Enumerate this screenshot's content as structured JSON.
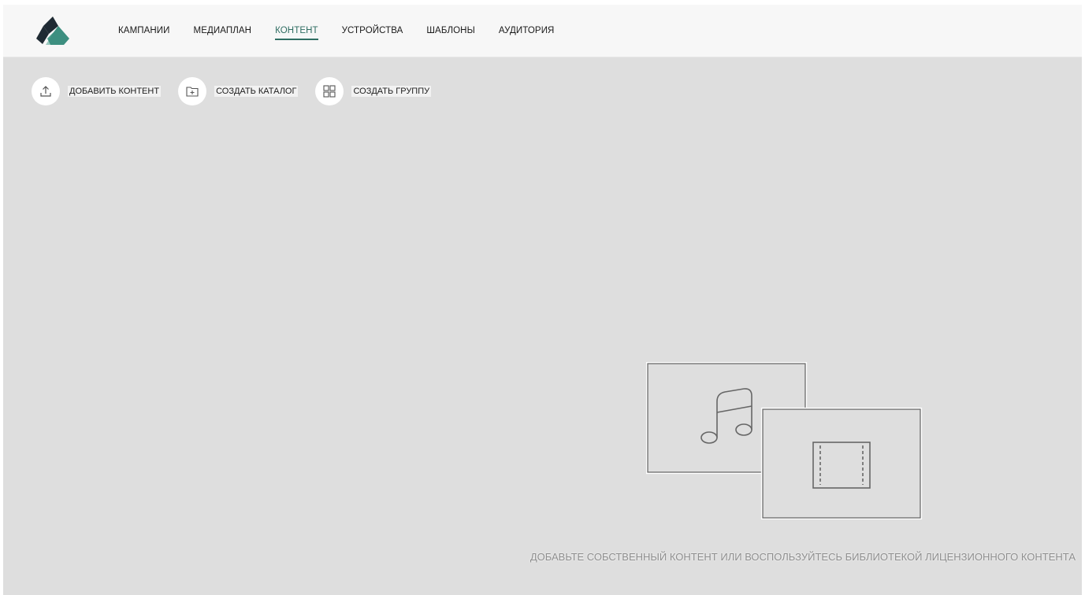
{
  "nav": {
    "items": [
      {
        "label": "КАМПАНИИ",
        "active": false
      },
      {
        "label": "МЕДИАПЛАН",
        "active": false
      },
      {
        "label": "КОНТЕНТ",
        "active": true
      },
      {
        "label": "УСТРОЙСТВА",
        "active": false
      },
      {
        "label": "ШАБЛОНЫ",
        "active": false
      },
      {
        "label": "АУДИТОРИЯ",
        "active": false
      }
    ]
  },
  "toolbar": {
    "add_content": {
      "label": "ДОБАВИТЬ КОНТЕНТ",
      "icon": "upload-icon"
    },
    "create_catalog": {
      "label": "СОЗДАТЬ КАТАЛОГ",
      "icon": "folder-plus-icon"
    },
    "create_group": {
      "label": "СОЗДАТЬ ГРУППУ",
      "icon": "grid-icon"
    }
  },
  "empty_state": {
    "message": "ДОБАВЬТЕ СОБСТВЕННЫЙ КОНТЕНТ ИЛИ ВОСПОЛЬЗУЙТЕСЬ БИБЛИОТЕКОЙ ЛИЦЕНЗИОННОГО КОНТЕНТА",
    "icons": [
      "music-note-icon",
      "film-icon"
    ]
  },
  "colors": {
    "accent": "#2f6d62",
    "logo_dark": "#1f2a33",
    "logo_teal": "#3d8f80",
    "background": "#dedede",
    "header": "#f7f7f7"
  }
}
